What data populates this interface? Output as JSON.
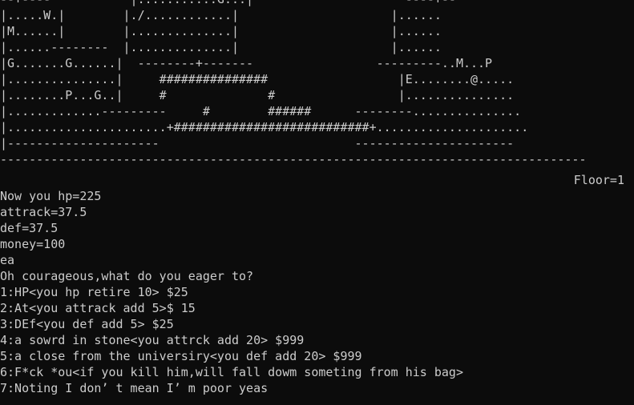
{
  "map": {
    "rows": [
      "--+----           |...........G...|                     ----+--",
      "|.....W.|        |./............|                     |......",
      "|M......|        |..............|                     |......",
      "|......--------  |..............|                     |......",
      "|G.......G......|  --------+-------                 ---------..M...P",
      "|...............|     ###############                  |E........@.....",
      "|........P...G..|     #              #                 |...............",
      "|.............---------     #        ######      --------...............",
      "|......................+###########################+.....................",
      "|---------------------                           ----------------------",
      "---------------------------------------------------------------------------------"
    ]
  },
  "floor_label": "Floor=1",
  "status": {
    "hp": "Now you hp=225",
    "attack": "attrack=37.5",
    "def": "def=37.5",
    "money": "money=100",
    "input_echo": "ea",
    "prompt": "Oh courageous,what do you eager to?"
  },
  "shop": {
    "options": [
      "1:HP<you hp retire 10> $25",
      "2:At<you attrack add 5>$ 15",
      "3:DEf<you def add 5> $25",
      "4:a sowrd in stone<you attrck add 20> $999",
      "5:a close from the universiry<you def add 20> $999",
      "6:F*ck *ou<if you kill him,will fall dowm someting from his bag>",
      "7:Noting I don’ t mean I’ m poor yeas"
    ]
  }
}
